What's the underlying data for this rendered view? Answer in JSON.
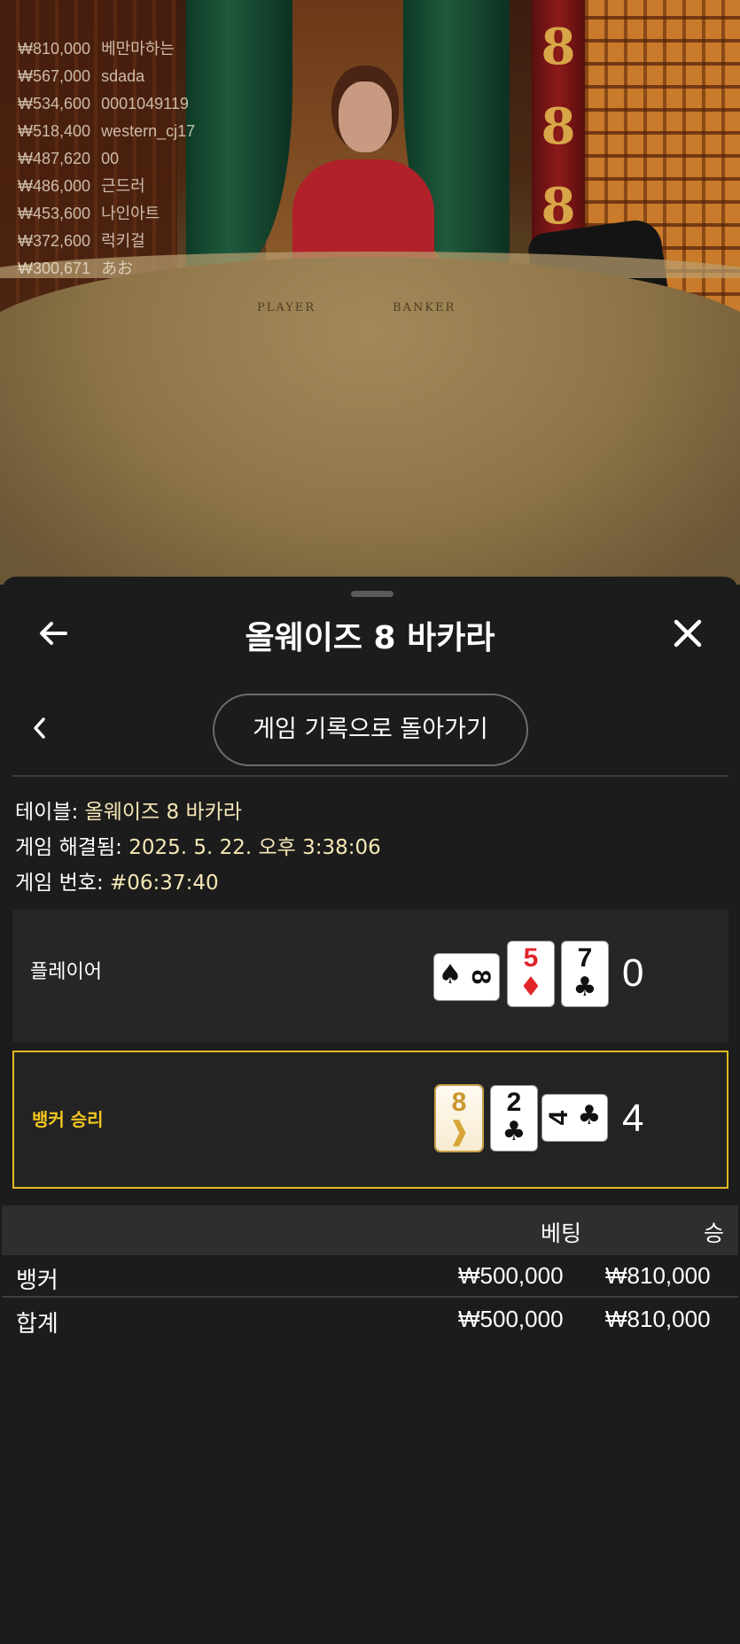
{
  "video": {
    "felt_player": "PLAYER",
    "felt_banker": "BANKER",
    "leaderboard": [
      {
        "amount": "₩810,000",
        "name": "베만마하는"
      },
      {
        "amount": "₩567,000",
        "name": "sdada"
      },
      {
        "amount": "₩534,600",
        "name": "0001049119"
      },
      {
        "amount": "₩518,400",
        "name": "western_cj17"
      },
      {
        "amount": "₩487,620",
        "name": "00"
      },
      {
        "amount": "₩486,000",
        "name": "근드러"
      },
      {
        "amount": "₩453,600",
        "name": "나인아트"
      },
      {
        "amount": "₩372,600",
        "name": "럭키걸"
      },
      {
        "amount": "₩300,671",
        "name": "あお"
      }
    ]
  },
  "header": {
    "title": "올웨이즈 8 바카라",
    "back_icon": "arrow-left-icon",
    "close_icon": "close-icon"
  },
  "nav": {
    "back_icon": "chevron-left-icon",
    "history_button": "게임 기록으로 돌아가기"
  },
  "info": {
    "table_label": "테이블:",
    "table_value": "올웨이즈 8 바카라",
    "resolved_label": "게임 해결됨:",
    "resolved_value": "2025. 5. 22. 오후 3:38:06",
    "game_no_label": "게임 번호:",
    "game_no_value": "#06:37:40"
  },
  "hands": {
    "player": {
      "label": "플레이어",
      "score": "0",
      "cards": [
        {
          "rank": "8",
          "suit": "♠",
          "color": "#111111",
          "orientation": "horizontal"
        },
        {
          "rank": "5",
          "suit": "♦",
          "color": "#e0262b",
          "orientation": "vertical"
        },
        {
          "rank": "7",
          "suit": "♣",
          "color": "#111111",
          "orientation": "vertical"
        }
      ]
    },
    "banker": {
      "label": "뱅커 승리",
      "score": "4",
      "accent": "#e2b921",
      "cards": [
        {
          "rank": "8",
          "suit": "❱",
          "color": "#c9962e",
          "orientation": "vertical"
        },
        {
          "rank": "2",
          "suit": "♣",
          "color": "#111111",
          "orientation": "vertical"
        },
        {
          "rank": "4",
          "suit": "♣",
          "color": "#111111",
          "orientation": "horizontal"
        }
      ]
    }
  },
  "bets": {
    "col_bet": "베팅",
    "col_win": "승",
    "rows": [
      {
        "name": "뱅커",
        "bet": "₩500,000",
        "win": "₩810,000"
      }
    ],
    "total": {
      "name": "합계",
      "bet": "₩500,000",
      "win": "₩810,000"
    }
  }
}
